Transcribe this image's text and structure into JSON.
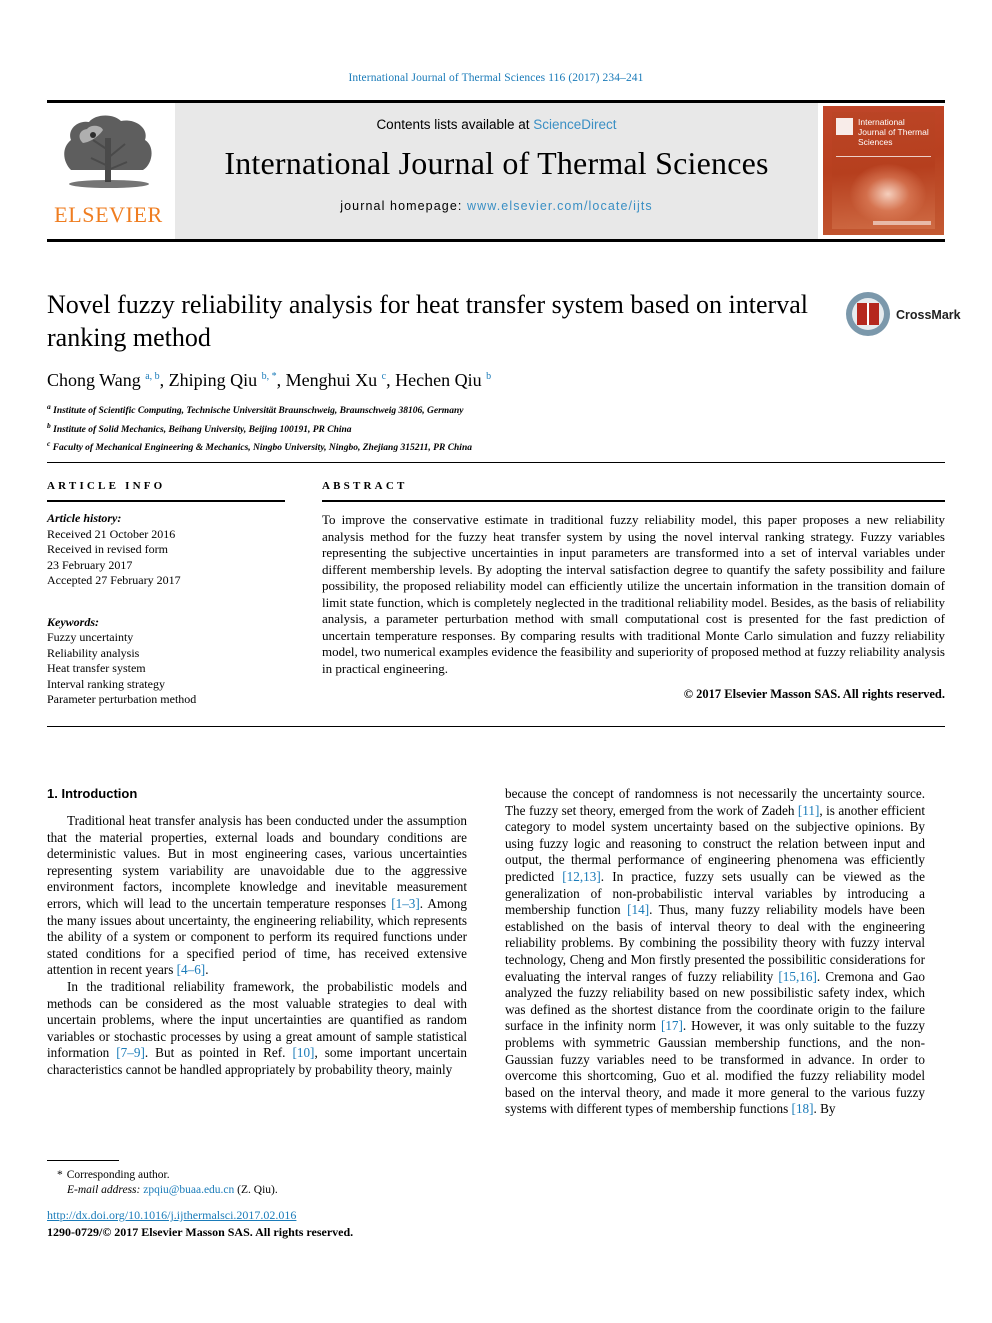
{
  "running_head": "International Journal of Thermal Sciences 116 (2017) 234–241",
  "masthead": {
    "publisher_name": "ELSEVIER",
    "contents_prefix": "Contents lists available at ",
    "contents_link": "ScienceDirect",
    "journal_title": "International Journal of Thermal Sciences",
    "homepage_label": "journal homepage: ",
    "homepage_url": "www.elsevier.com/locate/ijts",
    "cover_title": "International Journal of Thermal Sciences"
  },
  "article": {
    "title": "Novel fuzzy reliability analysis for heat transfer system based on interval ranking method",
    "authors_html": "Chong Wang <sup>a, b</sup>, Zhiping Qiu <sup>b, *</sup>, Menghui Xu <sup>c</sup>, Hechen Qiu <sup>b</sup>",
    "affiliations": [
      "Institute of Scientific Computing, Technische Universität Braunschweig, Braunschweig 38106, Germany",
      "Institute of Solid Mechanics, Beihang University, Beijing 100191, PR China",
      "Faculty of Mechanical Engineering & Mechanics, Ningbo University, Ningbo, Zhejiang 315211, PR China"
    ],
    "affiliation_markers": [
      "a",
      "b",
      "c"
    ]
  },
  "crossmark": {
    "label": "CrossMark"
  },
  "article_info": {
    "heading": "ARTICLE INFO",
    "history_label": "Article history:",
    "history_lines": [
      "Received 21 October 2016",
      "Received in revised form",
      "23 February 2017",
      "Accepted 27 February 2017"
    ],
    "keywords_label": "Keywords:",
    "keywords": [
      "Fuzzy uncertainty",
      "Reliability analysis",
      "Heat transfer system",
      "Interval ranking strategy",
      "Parameter perturbation method"
    ]
  },
  "abstract": {
    "heading": "ABSTRACT",
    "text": "To improve the conservative estimate in traditional fuzzy reliability model, this paper proposes a new reliability analysis method for the fuzzy heat transfer system by using the novel interval ranking strategy. Fuzzy variables representing the subjective uncertainties in input parameters are transformed into a set of interval variables under different membership levels. By adopting the interval satisfaction degree to quantify the safety possibility and failure possibility, the proposed reliability model can efficiently utilize the uncertain information in the transition domain of limit state function, which is completely neglected in the traditional reliability model. Besides, as the basis of reliability analysis, a parameter perturbation method with small computational cost is presented for the fast prediction of uncertain temperature responses. By comparing results with traditional Monte Carlo simulation and fuzzy reliability model, two numerical examples evidence the feasibility and superiority of proposed method at fuzzy reliability analysis in practical engineering.",
    "rights": "© 2017 Elsevier Masson SAS. All rights reserved."
  },
  "body": {
    "section_heading": "1. Introduction",
    "left_paragraphs": [
      "Traditional heat transfer analysis has been conducted under the assumption that the material properties, external loads and boundary conditions are deterministic values. But in most engineering cases, various uncertainties representing system variability are unavoidable due to the aggressive environment factors, incomplete knowledge and inevitable measurement errors, which will lead to the uncertain temperature responses [1–3]. Among the many issues about uncertainty, the engineering reliability, which represents the ability of a system or component to perform its required functions under stated conditions for a specified period of time, has received extensive attention in recent years [4–6].",
      "In the traditional reliability framework, the probabilistic models and methods can be considered as the most valuable strategies to deal with uncertain problems, where the input uncertainties are quantified as random variables or stochastic processes by using a great amount of sample statistical information [7–9]. But as pointed in Ref. [10], some important uncertain characteristics cannot be handled appropriately by probability theory, mainly"
    ],
    "right_paragraphs": [
      "because the concept of randomness is not necessarily the uncertainty source. The fuzzy set theory, emerged from the work of Zadeh [11], is another efficient category to model system uncertainty based on the subjective opinions. By using fuzzy logic and reasoning to construct the relation between input and output, the thermal performance of engineering phenomena was efficiently predicted [12,13]. In practice, fuzzy sets usually can be viewed as the generalization of non-probabilistic interval variables by introducing a membership function [14]. Thus, many fuzzy reliability models have been established on the basis of interval theory to deal with the engineering reliability problems. By combining the possibility theory with fuzzy interval technology, Cheng and Mon firstly presented the possibilitic considerations for evaluating the interval ranges of fuzzy reliability [15,16]. Cremona and Gao analyzed the fuzzy reliability based on new possibilistic safety index, which was defined as the shortest distance from the coordinate origin to the failure surface in the infinity norm [17]. However, it was only suitable to the fuzzy problems with symmetric Gaussian membership functions, and the non-Gaussian fuzzy variables need to be transformed in advance. In order to overcome this shortcoming, Guo et al. modified the fuzzy reliability model based on the interval theory, and made it more general to the various fuzzy systems with different types of membership functions [18]. By"
    ]
  },
  "footnote": {
    "star": "*",
    "corresponding": "Corresponding author.",
    "email_label": "E-mail address:",
    "email": "zpqiu@buaa.edu.cn",
    "email_suffix": "(Z. Qiu)."
  },
  "footer": {
    "doi": "http://dx.doi.org/10.1016/j.ijthermalsci.2017.02.016",
    "issn_line": "1290-0729/© 2017 Elsevier Masson SAS. All rights reserved."
  },
  "colors": {
    "link_blue": "#1a7bb9",
    "elsevier_orange": "#ef7d20",
    "cover_red": "#bb4526",
    "band_grey": "#e8e8e8"
  }
}
